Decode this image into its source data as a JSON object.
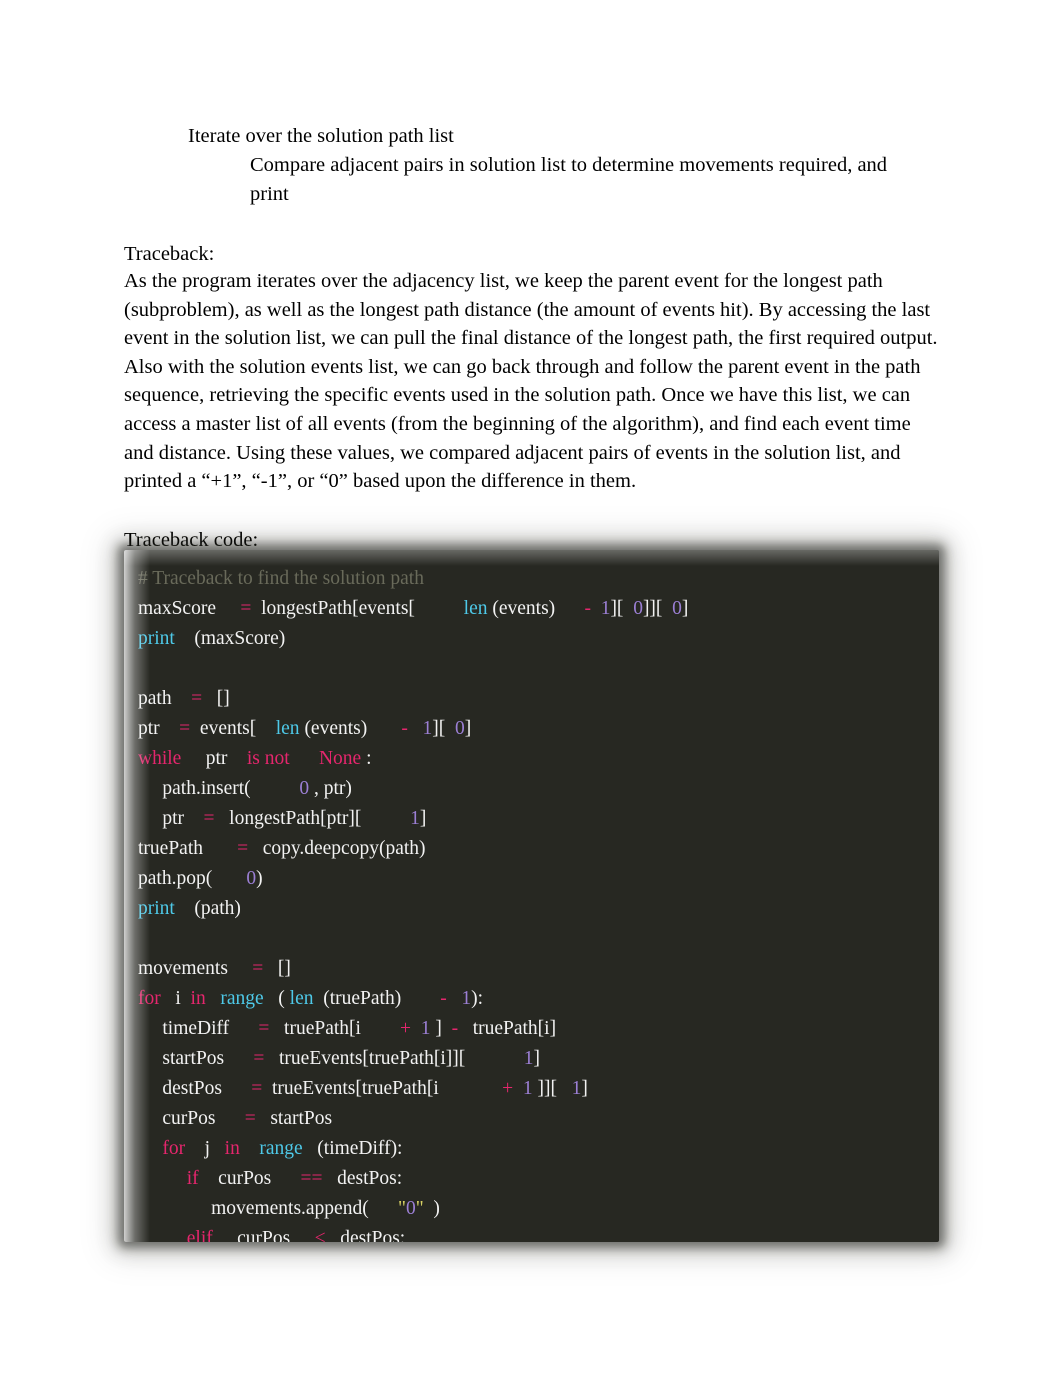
{
  "document": {
    "outline": {
      "level1": "Iterate over the solution path list",
      "level2": "Compare adjacent pairs in solution list to determine movements required, and print"
    },
    "headings": {
      "traceback": "Traceback:",
      "traceback_code": "Traceback code:"
    },
    "paragraph": "As the program iterates over the adjacency list, we keep the parent event for the longest path (subproblem), as well as the longest path distance (the amount of events hit). By accessing the last event in the solution list, we can pull the final distance of the longest path, the first required output. Also with the solution events list, we can go back through and follow the parent event in the path sequence, retrieving the specific events used in the solution path. Once we have this list, we can access a master list of all events (from the beginning of the algorithm), and find each event time and distance. Using these values, we compared adjacent pairs of events in the solution list, and printed a “+1”, “-1”, or “0” based upon the difference in them."
  },
  "code_block": {
    "language": "python",
    "background_color": "#272822",
    "colors": {
      "text": "#f2f2f2",
      "comment": "#6f705f",
      "keyword": "#e5266d",
      "builtin": "#4ec9e8",
      "number": "#9b7fd4",
      "string": "#d8d264",
      "operator": "#e5266d"
    },
    "lines": [
      "# Traceback to find the solution path",
      "maxScore     =  longestPath[events[          len (events)      -  1][  0]][  0]",
      "print    (maxScore)",
      "",
      "path    =   []",
      "ptr    =  events[    len (events)       -   1][  0]",
      "while     ptr    is not      None :",
      "     path.insert(          0 , ptr)",
      "     ptr    =   longestPath[ptr][          1]",
      "truePath       =   copy.deepcopy(path)",
      "path.pop(       0)",
      "print    (path)",
      "",
      "movements     =   []",
      "for   i  in   range   ( len  (truePath)        -   1):",
      "     timeDiff      =   truePath[i        +  1 ]  -   truePath[i]",
      "     startPos      =   trueEvents[truePath[i]][            1]",
      "     destPos      =  trueEvents[truePath[i             +  1 ]][   1]",
      "     curPos      =   startPos",
      "     for    j   in    range   (timeDiff):",
      "          if    curPos      ==   destPos:",
      "               movements.append(      \"0\"  )",
      "          elif     curPos     <   destPos:"
    ]
  }
}
